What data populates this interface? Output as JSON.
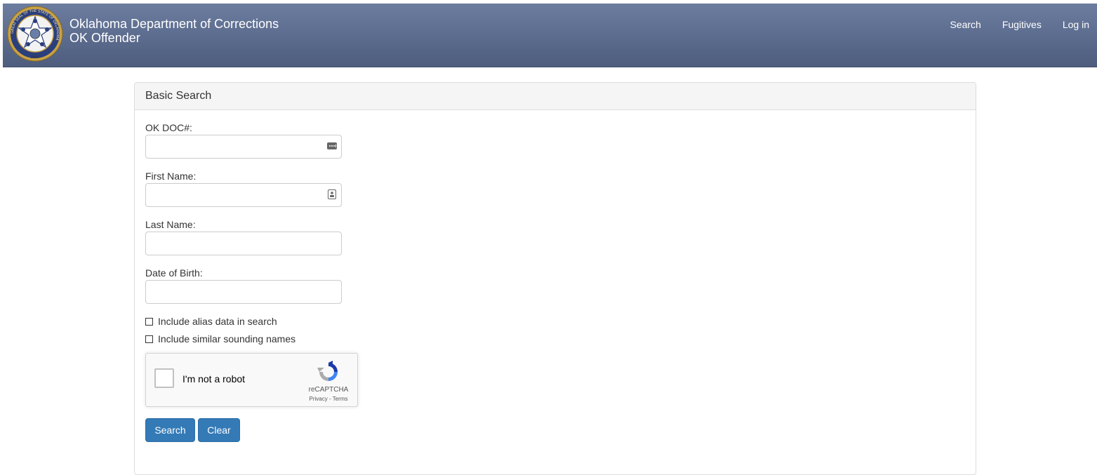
{
  "header": {
    "title_line1": "Oklahoma Department of Corrections",
    "title_line2": "OK Offender",
    "nav": [
      "Search",
      "Fugitives",
      "Log in"
    ],
    "seal_text": "GREAT SEAL OF THE STATE OF OKLAHOMA",
    "seal_year": "1907"
  },
  "panel": {
    "heading": "Basic Search",
    "fields": {
      "doc_label": "OK DOC#:",
      "doc_value": "",
      "first_label": "First Name:",
      "first_value": "",
      "last_label": "Last Name:",
      "last_value": "",
      "dob_label": "Date of Birth:",
      "dob_value": ""
    },
    "checkboxes": {
      "alias_label": "Include alias data in search",
      "similar_label": "Include similar sounding names"
    },
    "captcha": {
      "text": "I'm not a robot",
      "brand": "reCAPTCHA",
      "links": "Privacy - Terms"
    },
    "buttons": {
      "search": "Search",
      "clear": "Clear"
    }
  },
  "colors": {
    "header_top": "#6c7da0",
    "header_bottom": "#4e5d7e",
    "primary_button": "#337ab7"
  }
}
